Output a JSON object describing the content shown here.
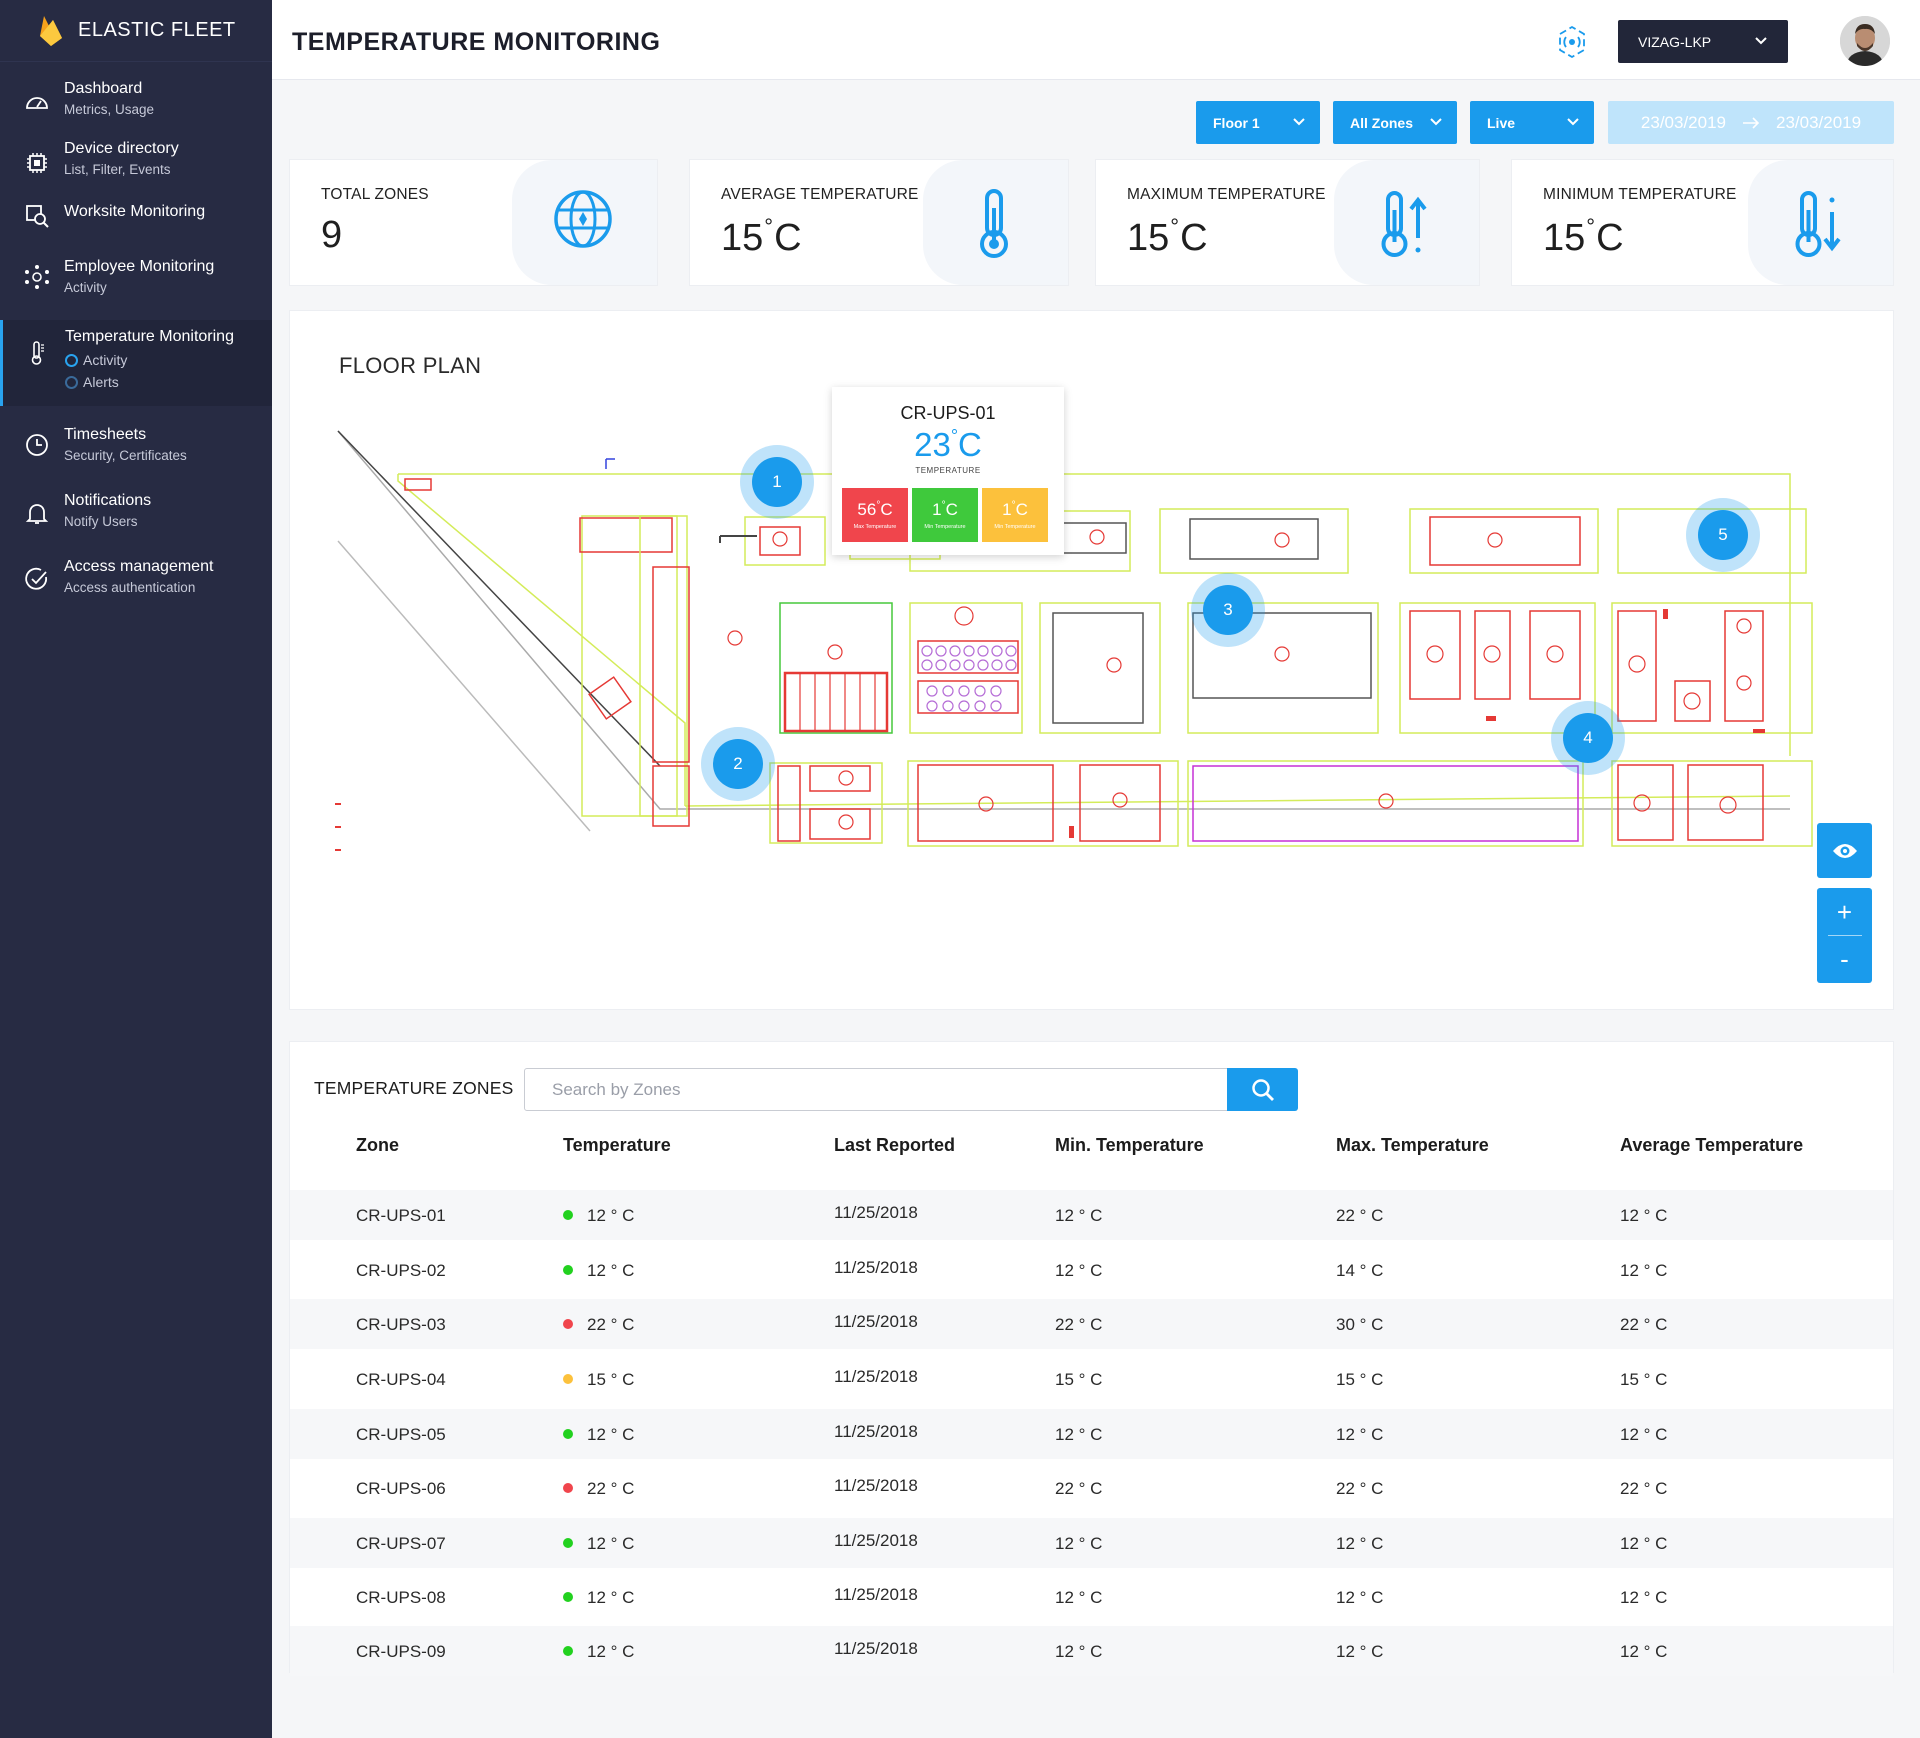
{
  "brand": {
    "name": "ELASTIC FLEET"
  },
  "sidebar": {
    "items": [
      {
        "title": "Dashboard",
        "sub": "Metrics, Usage"
      },
      {
        "title": "Device directory",
        "sub": "List, Filter, Events"
      },
      {
        "title": "Worksite Monitoring",
        "sub": ""
      },
      {
        "title": "Employee Monitoring",
        "sub": "Activity"
      },
      {
        "title": "Temperature Monitoring",
        "sub": ""
      },
      {
        "title": "Timesheets",
        "sub": "Security, Certificates"
      },
      {
        "title": "Notifications",
        "sub": "Notify Users"
      },
      {
        "title": "Access management",
        "sub": "Access authentication"
      }
    ],
    "temperature_sub": [
      "Activity",
      "Alerts"
    ]
  },
  "header": {
    "title": "TEMPERATURE MONITORING",
    "site": "VIZAG-LKP"
  },
  "filters": {
    "floor": "Floor 1",
    "zones": "All Zones",
    "mode": "Live",
    "date_from": "23/03/2019",
    "date_to": "23/03/2019"
  },
  "stats": [
    {
      "label": "TOTAL ZONES",
      "value": "9",
      "unit": ""
    },
    {
      "label": "AVERAGE TEMPERATURE",
      "value": "15",
      "unit": "C"
    },
    {
      "label": "MAXIMUM TEMPERATURE",
      "value": "15",
      "unit": "C"
    },
    {
      "label": "MINIMUM TEMPERATURE",
      "value": "15",
      "unit": "C"
    }
  ],
  "floorplan": {
    "title": "FLOOR PLAN",
    "markers": [
      "1",
      "2",
      "3",
      "4",
      "5"
    ],
    "tooltip": {
      "zone": "CR-UPS-01",
      "temp": "23",
      "unit": "C",
      "label": "TEMPERATURE",
      "max": {
        "value": "56",
        "unit": "C",
        "label": "Max Temperature",
        "color": "#f0454c"
      },
      "min": {
        "value": "1",
        "unit": "C",
        "label": "Min Temperature",
        "color": "#3fc93c"
      },
      "avg": {
        "value": "1",
        "unit": "C",
        "label": "Min Temperature",
        "color": "#fcc13c"
      }
    },
    "controls": {
      "view": "eye-icon",
      "zoom_in": "+",
      "zoom_out": "-"
    }
  },
  "zones": {
    "title": "TEMPERATURE ZONES",
    "search_placeholder": "Search by Zones",
    "columns": [
      "Zone",
      "Temperature",
      "Last Reported",
      "Min. Temperature",
      "Max. Temperature",
      "Average Temperature"
    ],
    "status_colors": {
      "green": "#22d11f",
      "red": "#f0454c",
      "yellow": "#fcc13c"
    },
    "rows": [
      {
        "zone": "CR-UPS-01",
        "temp": "12 ° C",
        "status": "green",
        "reported": "11/25/2018",
        "min": "12 ° C",
        "max": "22 ° C",
        "avg": "12 ° C"
      },
      {
        "zone": "CR-UPS-02",
        "temp": "12 ° C",
        "status": "green",
        "reported": "11/25/2018",
        "min": "12 ° C",
        "max": "14 ° C",
        "avg": "12 ° C"
      },
      {
        "zone": "CR-UPS-03",
        "temp": "22 ° C",
        "status": "red",
        "reported": "11/25/2018",
        "min": "22 ° C",
        "max": "30 ° C",
        "avg": "22 ° C"
      },
      {
        "zone": "CR-UPS-04",
        "temp": "15 ° C",
        "status": "yellow",
        "reported": "11/25/2018",
        "min": "15 ° C",
        "max": "15 ° C",
        "avg": "15 ° C"
      },
      {
        "zone": "CR-UPS-05",
        "temp": "12 ° C",
        "status": "green",
        "reported": "11/25/2018",
        "min": "12 ° C",
        "max": "12 ° C",
        "avg": "12 ° C"
      },
      {
        "zone": "CR-UPS-06",
        "temp": "22 ° C",
        "status": "red",
        "reported": "11/25/2018",
        "min": "22 ° C",
        "max": "22 ° C",
        "avg": "22 ° C"
      },
      {
        "zone": "CR-UPS-07",
        "temp": "12 ° C",
        "status": "green",
        "reported": "11/25/2018",
        "min": "12 ° C",
        "max": "12 ° C",
        "avg": "12 ° C"
      },
      {
        "zone": "CR-UPS-08",
        "temp": "12 ° C",
        "status": "green",
        "reported": "11/25/2018",
        "min": "12 ° C",
        "max": "12 ° C",
        "avg": "12 ° C"
      },
      {
        "zone": "CR-UPS-09",
        "temp": "12 ° C",
        "status": "green",
        "reported": "11/25/2018",
        "min": "12 ° C",
        "max": "12 ° C",
        "avg": "12 ° C"
      }
    ]
  }
}
